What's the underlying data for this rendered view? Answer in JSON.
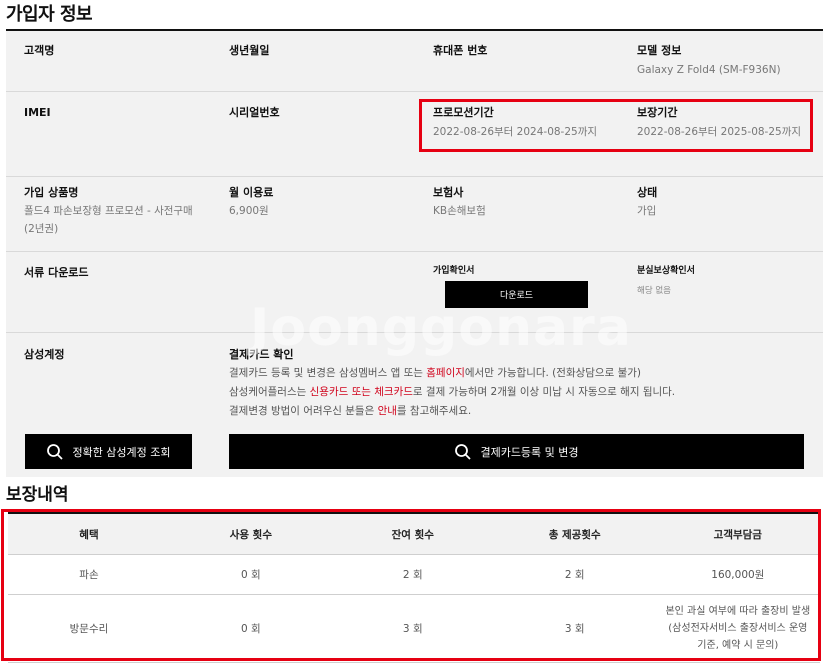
{
  "section_title": "가입자 정보",
  "subscriber": {
    "row1": {
      "customer_name": {
        "label": "고객명",
        "value": ""
      },
      "birth_date": {
        "label": "생년월일",
        "value": ""
      },
      "phone": {
        "label": "휴대폰 번호",
        "value": ""
      },
      "model": {
        "label": "모델 정보",
        "value": "Galaxy Z Fold4 (SM-F936N)"
      }
    },
    "row2": {
      "imei": {
        "label": "IMEI",
        "value": ""
      },
      "serial": {
        "label": "시리얼번호",
        "value": ""
      },
      "promo_period": {
        "label": "프로모션기간",
        "value": "2022-08-26부터 2024-08-25까지"
      },
      "warranty_period": {
        "label": "보장기간",
        "value": "2022-08-26부터 2025-08-25까지"
      }
    },
    "row3": {
      "product": {
        "label": "가입 상품명",
        "value_line1": "폴드4 파손보장형 프로모션 - 사전구매",
        "value_line2": "(2년권)"
      },
      "monthly_fee": {
        "label": "월 이용료",
        "value": "6,900원"
      },
      "insurer": {
        "label": "보험사",
        "value": "KB손해보험"
      },
      "status": {
        "label": "상태",
        "value": "가입"
      }
    },
    "row4": {
      "documents": {
        "label": "서류 다운로드"
      },
      "join_cert": {
        "label": "가입확인서",
        "button": "다운로드"
      },
      "loss_cert": {
        "label": "분실보상확인서",
        "value": "해당 없음"
      }
    },
    "row5": {
      "samsung_account": {
        "label": "삼성계정",
        "button": "정확한 삼성계정 조회"
      },
      "payment_card": {
        "label": "결제카드 확인",
        "line1_a": "결제카드 등록 및 변경은 삼성멤버스 앱 또는 ",
        "line1_link": "홈페이지",
        "line1_b": "에서만 가능합니다. (전화상담으로 불가)",
        "line2_a": "삼성케어플러스는 ",
        "line2_red": "신용카드 또는 체크카드",
        "line2_b": "로 결제 가능하며 2개월 이상 미납 시 자동으로 해지 됩니다.",
        "line3_a": "결제변경 방법이 어려우신 분들은 ",
        "line3_red": "안내",
        "line3_b": "를 참고해주세요.",
        "button": "결제카드등록 및 변경"
      }
    }
  },
  "watermark": "Joonggonara",
  "coverage_title": "보장내역",
  "coverage": {
    "headers": [
      "혜택",
      "사용 횟수",
      "잔여 횟수",
      "총 제공횟수",
      "고객부담금"
    ],
    "rows": [
      {
        "benefit": "파손",
        "used": "0 회",
        "remaining": "2 회",
        "total": "2 회",
        "fee": "160,000원"
      },
      {
        "benefit": "방문수리",
        "used": "0 회",
        "remaining": "3 회",
        "total": "3 회",
        "fee_line1": "본인 과실 여부에 따라 출장비 발생",
        "fee_line2": "(삼성전자서비스 출장서비스 운영",
        "fee_line3": "기준, 예약 시 문의)"
      }
    ]
  },
  "colors": {
    "highlight": "#e60012",
    "red_text": "#d0021b",
    "panel": "#f2f2f2"
  }
}
